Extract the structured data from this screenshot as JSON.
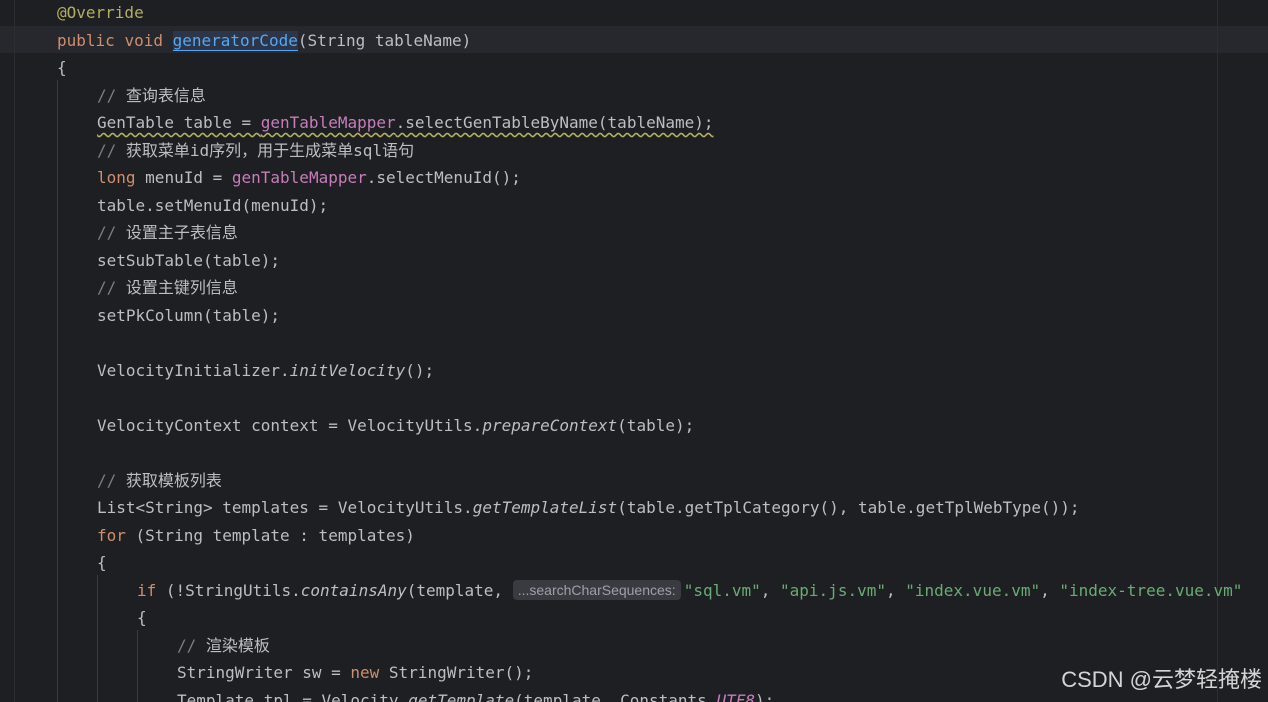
{
  "editor": {
    "lines": [
      {
        "indent": 0,
        "tokens": [
          {
            "t": "@Override",
            "c": "ann"
          }
        ]
      },
      {
        "indent": 0,
        "tokens": [
          {
            "t": "public ",
            "c": "kw"
          },
          {
            "t": "void ",
            "c": "kw"
          },
          {
            "t": "generatorCode",
            "c": "fn-decl selected-name"
          },
          {
            "t": "(String tableName)",
            "c": ""
          }
        ]
      },
      {
        "indent": 0,
        "tokens": [
          {
            "t": "{",
            "c": ""
          }
        ]
      },
      {
        "indent": 1,
        "tokens": [
          {
            "t": "// ",
            "c": "cm"
          },
          {
            "t": "查询表信息",
            "c": "cm-cn"
          }
        ]
      },
      {
        "indent": 1,
        "tokens": [
          {
            "t": "GenTable table = ",
            "c": "warn-underline"
          },
          {
            "t": "genTableMapper",
            "c": "field warn-underline"
          },
          {
            "t": ".selectGenTableByName(tableName);",
            "c": "warn-underline"
          }
        ]
      },
      {
        "indent": 1,
        "tokens": [
          {
            "t": "// ",
            "c": "cm"
          },
          {
            "t": "获取菜单id序列，用于生成菜单sql语句",
            "c": "cm-cn"
          }
        ]
      },
      {
        "indent": 1,
        "tokens": [
          {
            "t": "long ",
            "c": "kw"
          },
          {
            "t": "menuId = ",
            "c": ""
          },
          {
            "t": "genTableMapper",
            "c": "field"
          },
          {
            "t": ".selectMenuId();",
            "c": ""
          }
        ]
      },
      {
        "indent": 1,
        "tokens": [
          {
            "t": "table.setMenuId(menuId);",
            "c": ""
          }
        ]
      },
      {
        "indent": 1,
        "tokens": [
          {
            "t": "// ",
            "c": "cm"
          },
          {
            "t": "设置主子表信息",
            "c": "cm-cn"
          }
        ]
      },
      {
        "indent": 1,
        "tokens": [
          {
            "t": "setSubTable(table);",
            "c": ""
          }
        ]
      },
      {
        "indent": 1,
        "tokens": [
          {
            "t": "// ",
            "c": "cm"
          },
          {
            "t": "设置主键列信息",
            "c": "cm-cn"
          }
        ]
      },
      {
        "indent": 1,
        "tokens": [
          {
            "t": "setPkColumn(table);",
            "c": ""
          }
        ]
      },
      {
        "indent": 1,
        "tokens": []
      },
      {
        "indent": 1,
        "tokens": [
          {
            "t": "VelocityInitializer.",
            "c": ""
          },
          {
            "t": "initVelocity",
            "c": "static-call"
          },
          {
            "t": "();",
            "c": ""
          }
        ]
      },
      {
        "indent": 1,
        "tokens": []
      },
      {
        "indent": 1,
        "tokens": [
          {
            "t": "VelocityContext context = VelocityUtils.",
            "c": ""
          },
          {
            "t": "prepareContext",
            "c": "static-call"
          },
          {
            "t": "(table);",
            "c": ""
          }
        ]
      },
      {
        "indent": 1,
        "tokens": []
      },
      {
        "indent": 1,
        "tokens": [
          {
            "t": "// ",
            "c": "cm"
          },
          {
            "t": "获取模板列表",
            "c": "cm-cn"
          }
        ]
      },
      {
        "indent": 1,
        "tokens": [
          {
            "t": "List<String> templates = VelocityUtils.",
            "c": ""
          },
          {
            "t": "getTemplateList",
            "c": "static-call"
          },
          {
            "t": "(table.getTplCategory(), table.getTplWebType());",
            "c": ""
          }
        ]
      },
      {
        "indent": 1,
        "tokens": [
          {
            "t": "for ",
            "c": "kw"
          },
          {
            "t": "(String template : templates)",
            "c": ""
          }
        ]
      },
      {
        "indent": 1,
        "tokens": [
          {
            "t": "{",
            "c": ""
          }
        ]
      },
      {
        "indent": 2,
        "tokens": [
          {
            "t": "if ",
            "c": "kw"
          },
          {
            "t": "(!StringUtils.",
            "c": ""
          },
          {
            "t": "containsAny",
            "c": "static-call"
          },
          {
            "t": "(template, ",
            "c": ""
          },
          {
            "hint": "...searchCharSequences:"
          },
          {
            "t": "\"sql.vm\"",
            "c": "str"
          },
          {
            "t": ", ",
            "c": ""
          },
          {
            "t": "\"api.js.vm\"",
            "c": "str"
          },
          {
            "t": ", ",
            "c": ""
          },
          {
            "t": "\"index.vue.vm\"",
            "c": "str"
          },
          {
            "t": ", ",
            "c": ""
          },
          {
            "t": "\"index-tree.vue.vm\"",
            "c": "str"
          }
        ]
      },
      {
        "indent": 2,
        "tokens": [
          {
            "t": "{",
            "c": ""
          }
        ]
      },
      {
        "indent": 3,
        "tokens": [
          {
            "t": "// ",
            "c": "cm"
          },
          {
            "t": "渲染模板",
            "c": "cm-cn"
          }
        ]
      },
      {
        "indent": 3,
        "tokens": [
          {
            "t": "StringWriter sw = ",
            "c": ""
          },
          {
            "t": "new ",
            "c": "kw"
          },
          {
            "t": "StringWriter();",
            "c": ""
          }
        ]
      },
      {
        "indent": 3,
        "tokens": [
          {
            "t": "Template tpl = Velocity.",
            "c": ""
          },
          {
            "t": "getTemplate",
            "c": "static-call"
          },
          {
            "t": "(template, Constants.",
            "c": ""
          },
          {
            "t": "UTF8",
            "c": "const"
          },
          {
            "t": ");",
            "c": ""
          }
        ]
      }
    ]
  },
  "watermark": {
    "text": "CSDN @云梦轻掩楼"
  }
}
